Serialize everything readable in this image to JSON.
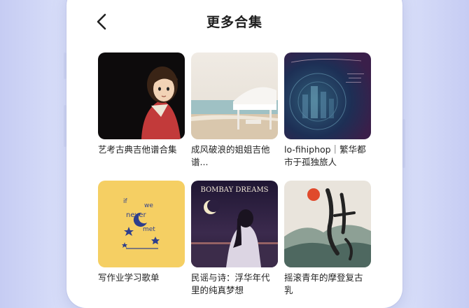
{
  "header": {
    "title": "更多合集",
    "back_icon": "chevron-left-icon"
  },
  "collections": [
    {
      "label": "艺考古典吉他谱合集"
    },
    {
      "label": "成风破浪的姐姐吉他谱..."
    },
    {
      "label": "lo-fihiphop｜繁华都市于孤独旅人"
    },
    {
      "label": "写作业学习歌单"
    },
    {
      "label": "民谣与诗：浮华年代里的纯真梦想"
    },
    {
      "label": "摇滚青年的摩登复古乳"
    }
  ],
  "cover_text": {
    "c4_line1": "if",
    "c4_line2": "we",
    "c4_line3": "never",
    "c4_line4": "met",
    "c5_title": "BOMBAY DREAMS"
  },
  "colors": {
    "background": "#d6dcf8",
    "panel": "#ffffff",
    "text": "#222222"
  }
}
